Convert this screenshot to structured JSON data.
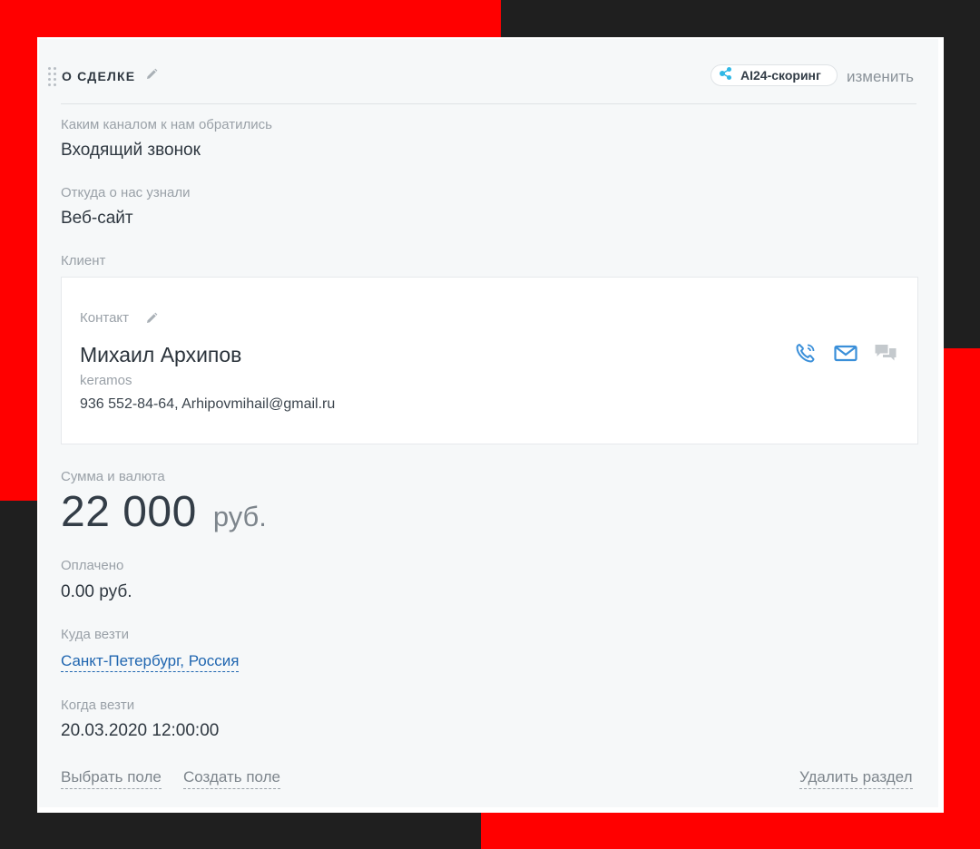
{
  "section": {
    "title": "О СДЕЛКЕ",
    "ai_badge_label": "AI24-скоринг",
    "change_label": "изменить"
  },
  "fields": {
    "channel": {
      "label": "Каким каналом к нам обратились",
      "value": "Входящий звонок"
    },
    "source": {
      "label": "Откуда о нас узнали",
      "value": "Веб-сайт"
    },
    "client": {
      "label": "Клиент"
    },
    "amount": {
      "label": "Сумма и валюта",
      "value": "22 000",
      "currency": "руб."
    },
    "paid": {
      "label": "Оплачено",
      "value": "0.00 руб."
    },
    "destination": {
      "label": "Куда везти",
      "value": "Санкт-Петербург, Россия"
    },
    "delivery_time": {
      "label": "Когда везти",
      "value": "20.03.2020 12:00:00"
    }
  },
  "contact": {
    "label": "Контакт",
    "name": "Михаил Архипов",
    "company": "keramos",
    "details": "936 552-84-64, Arhipovmihail@gmail.ru",
    "actions": [
      "phone-icon",
      "mail-icon",
      "chat-icon"
    ]
  },
  "footer": {
    "select_field": "Выбрать поле",
    "create_field": "Создать поле",
    "delete_section": "Удалить раздел"
  },
  "colors": {
    "accent_blue": "#2066b0",
    "icon_blue": "#3a8fd9",
    "background_red": "#ff0000",
    "background_dark": "#1f1f1f",
    "ai_node_blue": "#2fb8e6"
  }
}
